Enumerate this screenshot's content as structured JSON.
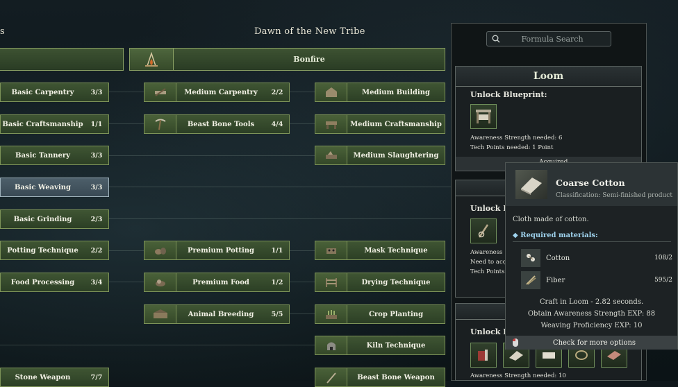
{
  "header": {
    "left_fragment": "s",
    "era_title": "Dawn of the New Tribe"
  },
  "bonfire": {
    "label": "Bonfire",
    "icon": "bonfire-icon"
  },
  "col1": [
    {
      "label": "Basic Carpentry",
      "count": "3/3"
    },
    {
      "label": "Basic Craftsmanship",
      "count": "1/1"
    },
    {
      "label": "Basic Tannery",
      "count": "3/3"
    },
    {
      "label": "Basic Weaving",
      "count": "3/3",
      "selected": true
    },
    {
      "label": "Basic Grinding",
      "count": "2/3"
    },
    {
      "label": "Potting Technique",
      "count": "2/2"
    },
    {
      "label": "Food Processing",
      "count": "3/4"
    },
    {
      "label": "Stone Weapon",
      "count": "7/7"
    }
  ],
  "col2": [
    {
      "label": "Medium Carpentry",
      "count": "2/2",
      "icon": "saw-icon"
    },
    {
      "label": "Beast Bone Tools",
      "count": "4/4",
      "icon": "pickaxe-icon"
    },
    {
      "label": "Premium Potting",
      "count": "1/1",
      "icon": "pottery-icon"
    },
    {
      "label": "Premium Food",
      "count": "1/2",
      "icon": "food-icon"
    },
    {
      "label": "Animal Breeding",
      "count": "5/5",
      "icon": "pen-icon"
    }
  ],
  "col3": [
    {
      "label": "Medium Building",
      "icon": "building-icon"
    },
    {
      "label": "Medium Craftsmanship",
      "icon": "workbench-icon"
    },
    {
      "label": "Medium Slaughtering",
      "icon": "slaughter-icon"
    },
    {
      "label": "Mask Technique",
      "icon": "mask-icon"
    },
    {
      "label": "Drying Technique",
      "icon": "rack-icon"
    },
    {
      "label": "Crop Planting",
      "icon": "crop-icon"
    },
    {
      "label": "Kiln Technique",
      "icon": "kiln-icon"
    },
    {
      "label": "Beast Bone Weapon",
      "icon": "spear-icon"
    }
  ],
  "search": {
    "placeholder": "Formula Search"
  },
  "loom_card": {
    "title": "Loom",
    "unlock_label": "Unlock Blueprint:",
    "strength": "Awareness Strength needed: 6",
    "tech": "Tech Points needed: 1 Point",
    "cut": "Acquired"
  },
  "card2": {
    "unlock_label": "Unlock Bl",
    "line1": "Awareness",
    "line2": "Need to acqu",
    "line3": "Tech Points"
  },
  "card3": {
    "unlock_label": "Unlock Bl",
    "strength": "Awareness Strength needed: 10"
  },
  "tooltip": {
    "name": "Coarse Cotton",
    "classification": "Classification: Semi-finished product",
    "description": "Cloth made of cotton.",
    "required_header": "Required materials:",
    "materials": [
      {
        "name": "Cotton",
        "qty": "108/2"
      },
      {
        "name": "Fiber",
        "qty": "595/2"
      }
    ],
    "craft": "Craft in Loom - 2.82 seconds.",
    "exp1": "Obtain Awareness Strength EXP: 88",
    "exp2": "Weaving Proficiency EXP: 10",
    "footer": "Check for more options"
  },
  "colors": {
    "node_green": "#3f5533",
    "node_border": "#7d9358",
    "selected": "#4d5f6a",
    "accent_blue": "#9fd3ee"
  }
}
